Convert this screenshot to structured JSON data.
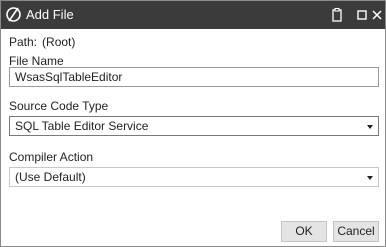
{
  "window": {
    "title": "Add File",
    "icons": {
      "app": "slashed-circle-icon",
      "copy": "clipboard-icon",
      "maximize": "maximize-icon",
      "close": "close-icon"
    }
  },
  "path": {
    "label": "Path:",
    "value": "(Root)"
  },
  "file_name": {
    "label": "File Name",
    "value": "WsasSqlTableEditor"
  },
  "source_code_type": {
    "label": "Source Code Type",
    "selected": "SQL Table Editor Service"
  },
  "compiler_action": {
    "label": "Compiler Action",
    "selected": "(Use Default)"
  },
  "buttons": {
    "ok": "OK",
    "cancel": "Cancel"
  },
  "colors": {
    "titlebar": "#3b3b3b",
    "button": "#e4e4e4"
  }
}
